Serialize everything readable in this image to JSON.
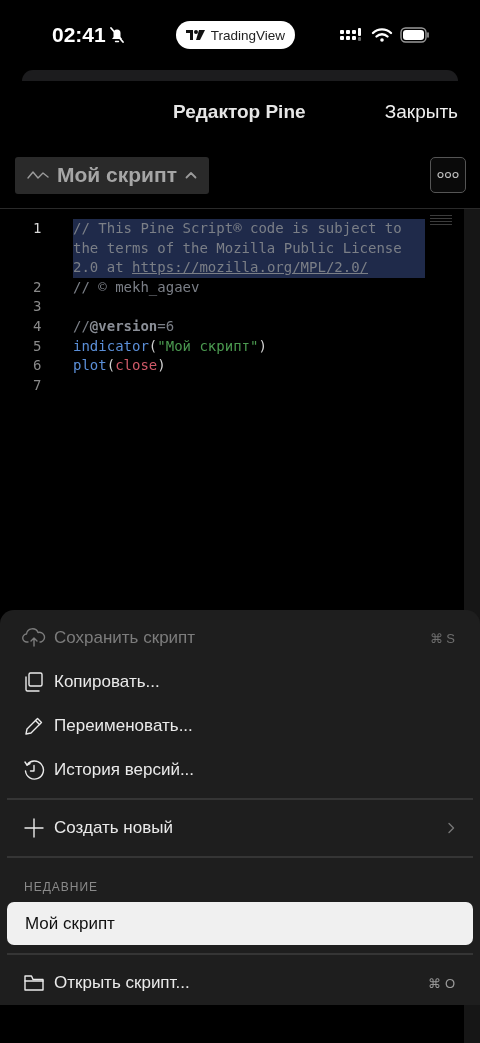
{
  "status_bar": {
    "time": "02:41",
    "app_pill": "TradingView"
  },
  "header": {
    "title": "Редактор Pine",
    "close": "Закрыть"
  },
  "toolbar": {
    "script_name": "Мой скрипт",
    "expanded": true
  },
  "editor": {
    "lines": [
      {
        "number": "1",
        "selected": true,
        "tokens": [
          {
            "kind": "comment",
            "text": "// This Pine Script® code is subject to the terms of the Mozilla Public License 2.0 at "
          },
          {
            "kind": "link",
            "text": "https://mozilla.org/MPL/2.0/"
          }
        ]
      },
      {
        "number": "2",
        "selected": false,
        "tokens": [
          {
            "kind": "comment",
            "text": "// © mekh_agaev"
          }
        ]
      },
      {
        "number": "3",
        "selected": false
      },
      {
        "number": "4",
        "selected": false,
        "tokens": [
          {
            "kind": "comment",
            "text": "//"
          },
          {
            "kind": "annotation",
            "text": "@version"
          },
          {
            "kind": "comment",
            "text": "=6"
          }
        ]
      },
      {
        "number": "5",
        "selected": false,
        "tokens": [
          {
            "kind": "function",
            "text": "indicator"
          },
          {
            "kind": "punct",
            "text": "("
          },
          {
            "kind": "string",
            "text": "\"Мой скрипт\""
          },
          {
            "kind": "punct",
            "text": ")"
          }
        ]
      },
      {
        "number": "6",
        "selected": false,
        "tokens": [
          {
            "kind": "function",
            "text": "plot"
          },
          {
            "kind": "punct",
            "text": "("
          },
          {
            "kind": "variable",
            "text": "close"
          },
          {
            "kind": "punct",
            "text": ")"
          }
        ]
      },
      {
        "number": "7",
        "selected": false
      }
    ]
  },
  "menu": {
    "items": [
      {
        "kind": "action",
        "label": "Сохранить скрипт",
        "shortcut": "⌘ S",
        "disabled": true,
        "submenu": false
      },
      {
        "kind": "action",
        "label": "Копировать...",
        "disabled": false,
        "submenu": false
      },
      {
        "kind": "action",
        "label": "Переименовать...",
        "disabled": false,
        "submenu": false
      },
      {
        "kind": "action",
        "label": "История версий...",
        "disabled": false,
        "submenu": false
      },
      {
        "kind": "divider"
      },
      {
        "kind": "action",
        "label": "Создать новый",
        "disabled": false,
        "submenu": true
      },
      {
        "kind": "divider"
      },
      {
        "kind": "section",
        "label": "НЕДАВНИЕ"
      },
      {
        "kind": "recent",
        "label": "Мой скрипт",
        "selected": true
      },
      {
        "kind": "divider"
      },
      {
        "kind": "action",
        "label": "Открыть скрипт...",
        "shortcut": "⌘ O",
        "disabled": false,
        "submenu": false
      }
    ]
  }
}
